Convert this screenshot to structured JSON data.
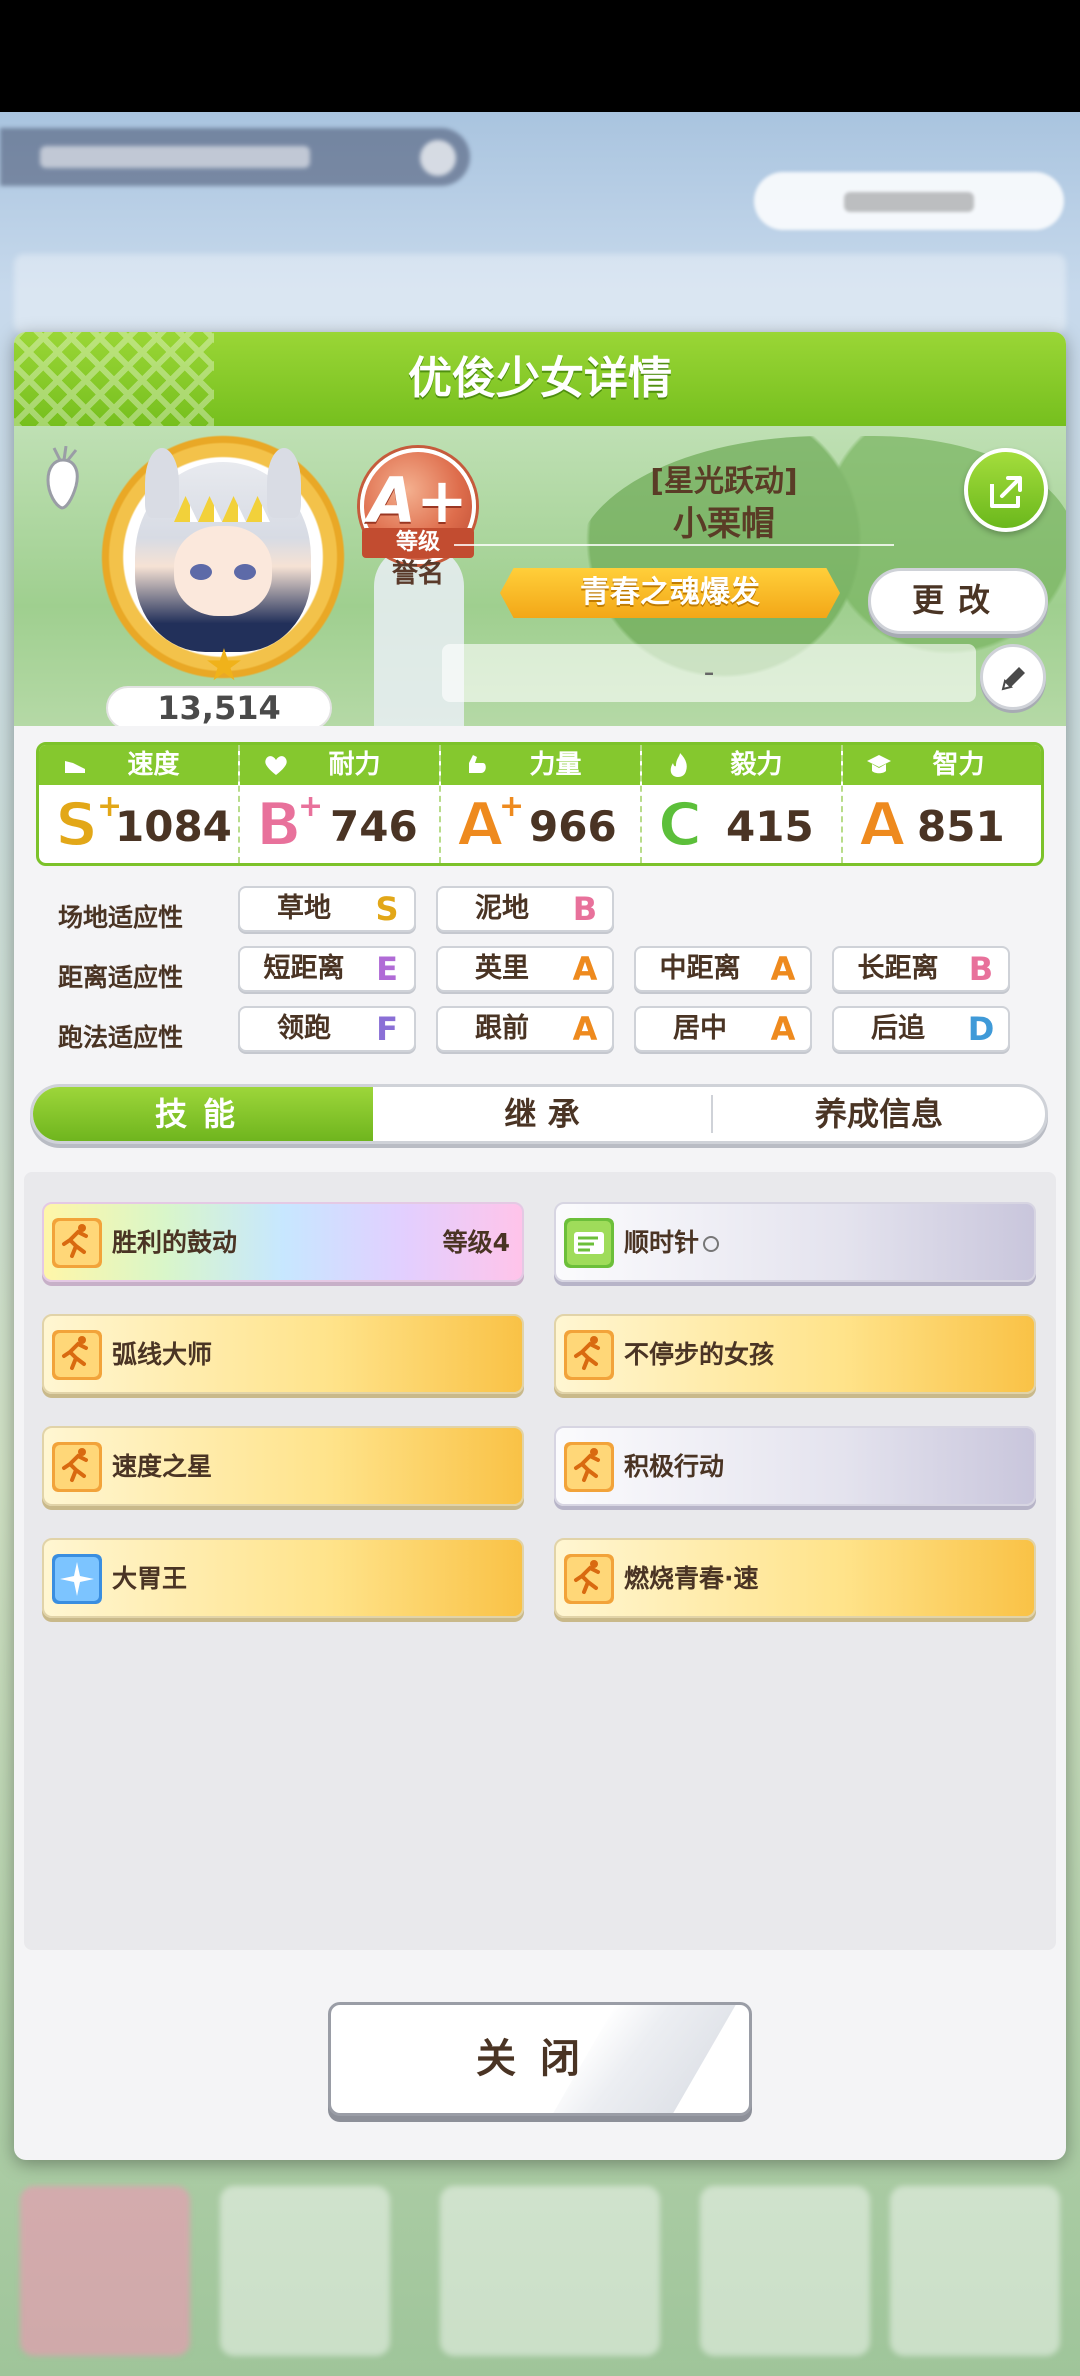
{
  "panel": {
    "title": "优俊少女详情"
  },
  "profile": {
    "score": "13,514",
    "rank_grade": "A+",
    "rank_ribbon": "等级",
    "rank_sub": "誉名",
    "costume_title": "[星光跃动]",
    "name": "小栗帽",
    "epithet": "青春之魂爆发",
    "change_label": "更改",
    "comment": "-"
  },
  "stats": [
    {
      "label": "速度",
      "grade": "S",
      "plus": "+",
      "value": "1084",
      "icon": "shoe-icon",
      "color": "#e2a718"
    },
    {
      "label": "耐力",
      "grade": "B",
      "plus": "+",
      "value": "746",
      "icon": "heart-icon",
      "color": "#e8719b"
    },
    {
      "label": "力量",
      "grade": "A",
      "plus": "+",
      "value": "966",
      "icon": "muscle-icon",
      "color": "#ee8a1e"
    },
    {
      "label": "毅力",
      "grade": "C",
      "plus": "",
      "value": "415",
      "icon": "flame-icon",
      "color": "#5cbf3a"
    },
    {
      "label": "智力",
      "grade": "A",
      "plus": "",
      "value": "851",
      "icon": "mortarboard-icon",
      "color": "#ee8a1e"
    }
  ],
  "aptitude": {
    "track_label": "场地适应性",
    "distance_label": "距离适应性",
    "style_label": "跑法适应性",
    "track": [
      {
        "name": "草地",
        "grade": "S"
      },
      {
        "name": "泥地",
        "grade": "B"
      }
    ],
    "distance": [
      {
        "name": "短距离",
        "grade": "E"
      },
      {
        "name": "英里",
        "grade": "A"
      },
      {
        "name": "中距离",
        "grade": "A"
      },
      {
        "name": "长距离",
        "grade": "B"
      }
    ],
    "style": [
      {
        "name": "领跑",
        "grade": "F"
      },
      {
        "name": "跟前",
        "grade": "A"
      },
      {
        "name": "居中",
        "grade": "A"
      },
      {
        "name": "后追",
        "grade": "D"
      }
    ]
  },
  "tabs": [
    "技能",
    "继 承",
    "养成信息"
  ],
  "skills": [
    {
      "name": "胜利的鼓动",
      "level": "等级4",
      "style": "rainbow"
    },
    {
      "name": "顺时针",
      "style": "gray"
    },
    {
      "name": "弧线大师",
      "style": "gold"
    },
    {
      "name": "不停步的女孩",
      "style": "gold"
    },
    {
      "name": "速度之星",
      "style": "gold"
    },
    {
      "name": "积极行动",
      "style": "gray"
    },
    {
      "name": "大胃王",
      "style": "gold"
    },
    {
      "name": "燃烧青春·速",
      "style": "gold"
    }
  ],
  "close_label": "关闭"
}
